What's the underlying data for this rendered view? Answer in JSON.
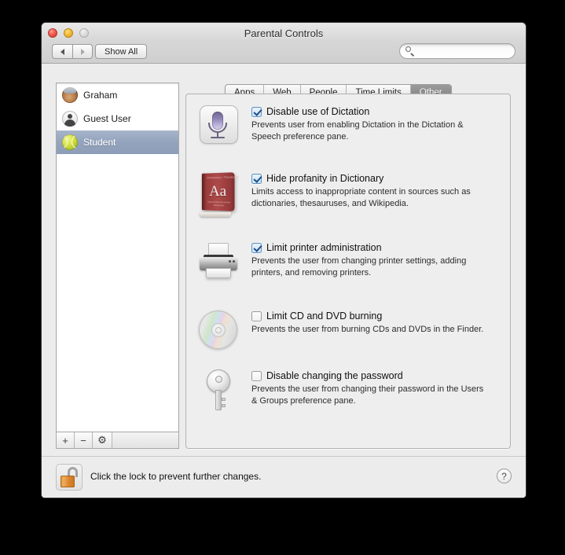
{
  "window": {
    "title": "Parental Controls",
    "traffic_lights": [
      "close",
      "minimize",
      "zoom"
    ]
  },
  "toolbar": {
    "back_icon": "triangle-left-icon",
    "forward_icon": "triangle-right-icon",
    "show_all_label": "Show All",
    "search": {
      "value": "",
      "placeholder": "",
      "icon": "search-icon"
    }
  },
  "sidebar": {
    "users": [
      {
        "name": "Graham",
        "avatar": "user-photo-avatar",
        "selected": false
      },
      {
        "name": "Guest User",
        "avatar": "guest-silhouette-avatar",
        "selected": false
      },
      {
        "name": "Student",
        "avatar": "tennis-ball-avatar",
        "selected": true
      }
    ],
    "footer": {
      "add_label": "+",
      "remove_label": "−",
      "gear_label": "⚙"
    }
  },
  "tabs": [
    {
      "label": "Apps",
      "active": false
    },
    {
      "label": "Web",
      "active": false
    },
    {
      "label": "People",
      "active": false
    },
    {
      "label": "Time Limits",
      "active": false
    },
    {
      "label": "Other",
      "active": true
    }
  ],
  "options": [
    {
      "icon": "microphone-icon",
      "checked": true,
      "label": "Disable use of Dictation",
      "description": "Prevents user from enabling Dictation in the Dictation & Speech preference pane."
    },
    {
      "icon": "dictionary-book-icon",
      "checked": true,
      "label": "Hide profanity in Dictionary",
      "description": "Limits access to inappropriate content in sources such as dictionaries, thesauruses, and Wikipedia.",
      "book_header": "Dictionary | Thesaurus",
      "book_glyph": "Aa",
      "book_subtitle": "New Oxford American Dictionary"
    },
    {
      "icon": "printer-icon",
      "checked": true,
      "label": "Limit printer administration",
      "description": "Prevents the user from changing printer settings, adding printers, and removing printers."
    },
    {
      "icon": "compact-disc-icon",
      "checked": false,
      "label": "Limit CD and DVD burning",
      "description": "Prevents the user from burning CDs and DVDs in the Finder."
    },
    {
      "icon": "key-icon",
      "checked": false,
      "label": "Disable changing the password",
      "description": "Prevents the user from changing their password in the Users & Groups preference pane."
    }
  ],
  "bottom_bar": {
    "lock_icon": "unlocked-padlock-icon",
    "lock_text": "Click the lock to prevent further changes.",
    "help_label": "?"
  },
  "colors": {
    "selection": "#93a3bc",
    "active_tab": "#8d8d8d",
    "checkbox_check": "#1b4f87",
    "lock_body": "#dd8831",
    "book_red": "#a3403f",
    "mic_purple": "#8e85b4"
  }
}
